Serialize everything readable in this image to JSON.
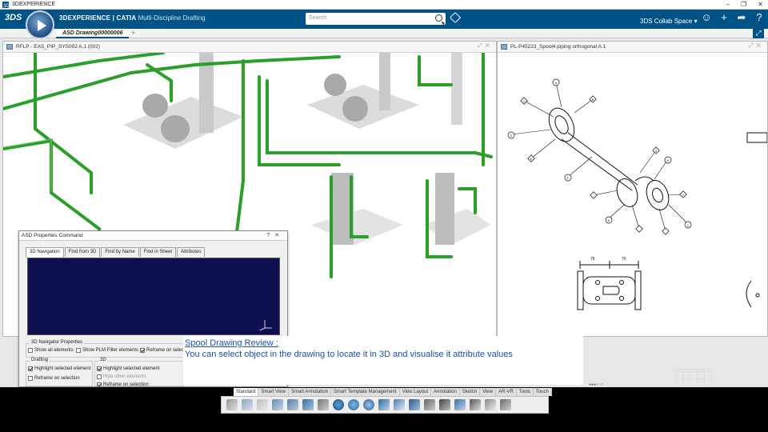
{
  "os": {
    "title": "3DEXPERIENCE"
  },
  "topbar": {
    "brand_bold": "3DEXPERIENCE | CATIA",
    "brand_sub": "Multi-Discipline Drafting",
    "search_placeholder": "Search",
    "collab_space": "3DS Collab Space",
    "icons": [
      "user-icon",
      "plus-icon",
      "share-icon",
      "help-icon"
    ]
  },
  "tabs": {
    "active": "ASD Drawing00000006"
  },
  "left_panel": {
    "title": "RFLP - EAS_PIP_SYS002 A.1 (002)"
  },
  "right_panel": {
    "title": "PL-P45223_Spool4 piping orthogonal A.1"
  },
  "drawing": {
    "balloons": [
      "A",
      "B",
      "C",
      "D",
      "E",
      "F",
      "G",
      "H",
      "I",
      "J",
      "K",
      "L"
    ],
    "dims": [
      "76",
      "75"
    ]
  },
  "dialog": {
    "title": "ASD Properties Command",
    "tabs": [
      "3D Navigation",
      "Find from 3D",
      "Find by Name",
      "Find in Sheet",
      "Attributes"
    ],
    "nav_props_label": "3D Navigator Properties",
    "nav_props": [
      {
        "label": "Show all elements",
        "checked": false
      },
      {
        "label": "Show PLM Filter elements",
        "checked": false
      },
      {
        "label": "Reframe on selec",
        "checked": true
      }
    ],
    "drafting_label": "Drafting",
    "drafting": [
      {
        "label": "Highlight selected element",
        "checked": true
      },
      {
        "label": "Reframe on selection",
        "checked": false
      }
    ],
    "threed_label": "3D",
    "threed": [
      {
        "label": "Highlight selected element",
        "checked": true
      },
      {
        "label": "Hide other elements",
        "checked": false,
        "disabled": true
      },
      {
        "label": "Reframe on selection",
        "checked": true
      }
    ]
  },
  "caption": {
    "heading": "Spool Drawing Review :",
    "body": "You can select object in the drawing to locate it in 3D and visualise it attribute values"
  },
  "toolbar": {
    "tabs": [
      "Standard",
      "Smart View",
      "Smart Annotation",
      "Smart Template Management",
      "View Layout",
      "Annotation",
      "Sketch",
      "View",
      "AR-VR",
      "Tools",
      "Touch"
    ],
    "active_tab": "Standard"
  },
  "colors": {
    "accent": "#005386",
    "pipe": "#2aa02a",
    "nav_bg": "#0d0f4f",
    "caption": "#1c4fa5"
  }
}
